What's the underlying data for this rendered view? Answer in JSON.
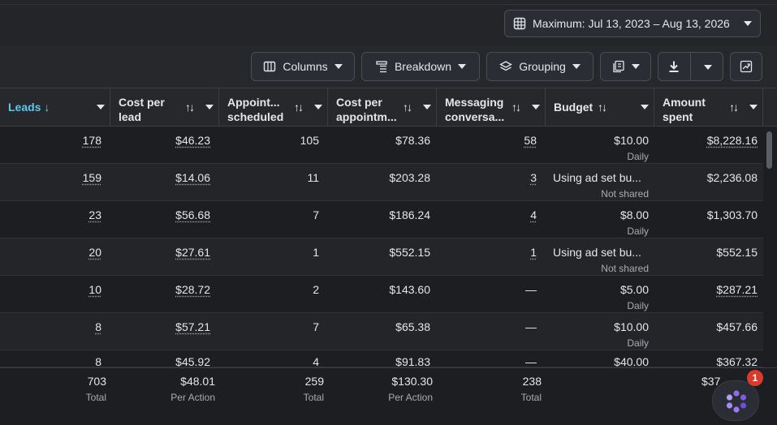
{
  "date_range": {
    "label": "Maximum: Jul 13, 2023 – Aug 13, 2026",
    "icon": "calendar-grid-icon"
  },
  "toolbar": {
    "columns_label": "Columns",
    "breakdown_label": "Breakdown",
    "grouping_label": "Grouping"
  },
  "columns": {
    "leads": "Leads ↓",
    "cost_per_lead_1": "Cost per",
    "cost_per_lead_2": "lead",
    "appt_1": "Appoint...",
    "appt_2": "scheduled",
    "cost_appt_1": "Cost per",
    "cost_appt_2": "appointm...",
    "msg_1": "Messaging",
    "msg_2": "conversa...",
    "budget": "Budget",
    "amount_1": "Amount",
    "amount_2": "spent"
  },
  "rows": [
    {
      "leads": "178",
      "cpl": "$46.23",
      "appt": "105",
      "cpa": "$78.36",
      "msg": "58",
      "budget": "$10.00",
      "budget_sub": "Daily",
      "spent": "$8,228.16"
    },
    {
      "leads": "159",
      "cpl": "$14.06",
      "appt": "11",
      "cpa": "$203.28",
      "msg": "3",
      "budget": "Using ad set bu...",
      "budget_sub": "Not shared",
      "spent": "$2,236.08"
    },
    {
      "leads": "23",
      "cpl": "$56.68",
      "appt": "7",
      "cpa": "$186.24",
      "msg": "4",
      "budget": "$8.00",
      "budget_sub": "Daily",
      "spent": "$1,303.70"
    },
    {
      "leads": "20",
      "cpl": "$27.61",
      "appt": "1",
      "cpa": "$552.15",
      "msg": "1",
      "budget": "Using ad set bu...",
      "budget_sub": "Not shared",
      "spent": "$552.15"
    },
    {
      "leads": "10",
      "cpl": "$28.72",
      "appt": "2",
      "cpa": "$143.60",
      "msg": "—",
      "budget": "$5.00",
      "budget_sub": "Daily",
      "spent": "$287.21"
    },
    {
      "leads": "8",
      "cpl": "$57.21",
      "appt": "7",
      "cpa": "$65.38",
      "msg": "—",
      "budget": "$10.00",
      "budget_sub": "Daily",
      "spent": "$457.66"
    },
    {
      "leads": "8",
      "cpl": "$45.92",
      "appt": "4",
      "cpa": "$91.83",
      "msg": "—",
      "budget": "$40.00",
      "budget_sub": "",
      "spent": "$367.32"
    }
  ],
  "totals": {
    "leads": "703",
    "leads_label": "Total",
    "cpl": "$48.01",
    "cpl_label": "Per Action",
    "appt": "259",
    "appt_label": "Total",
    "cpa": "$130.30",
    "cpa_label": "Per Action",
    "msg": "238",
    "msg_label": "Total",
    "spent": "$37"
  },
  "help": {
    "badge": "1"
  }
}
